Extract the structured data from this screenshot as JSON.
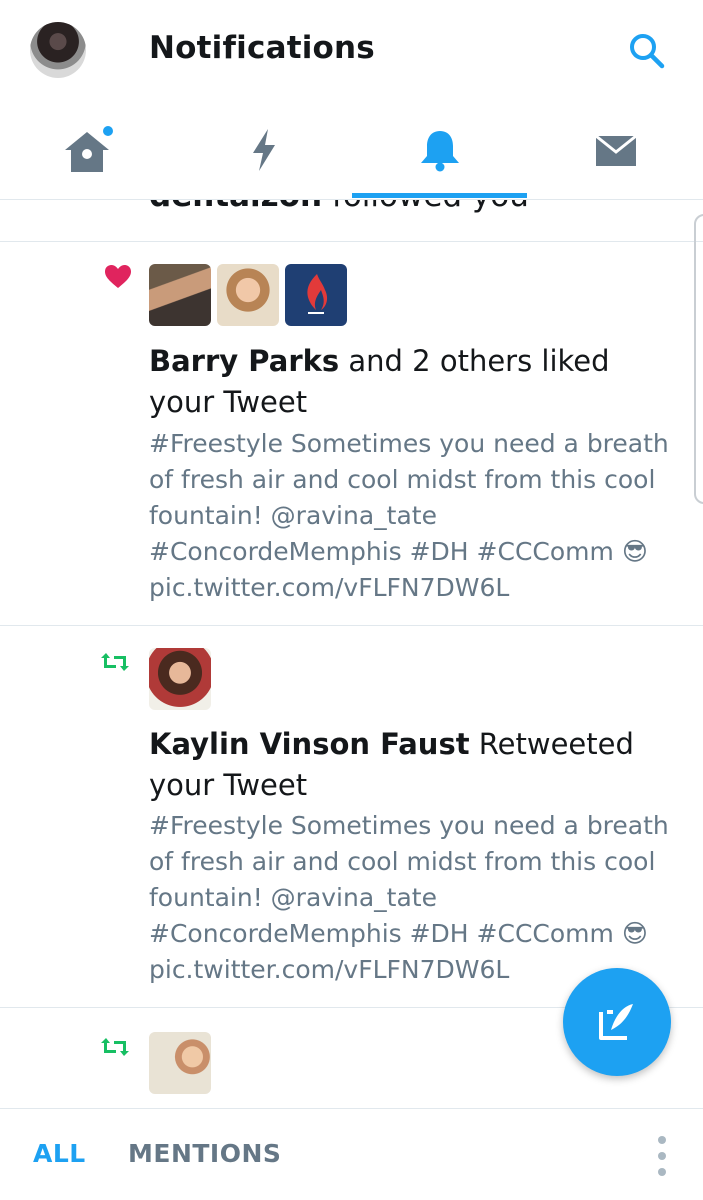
{
  "header": {
    "title": "Notifications"
  },
  "tabs": [
    {
      "name": "home",
      "icon": "home-icon",
      "has_dot": true
    },
    {
      "name": "moments",
      "icon": "lightning-icon"
    },
    {
      "name": "notifications",
      "icon": "bell-icon",
      "active": true
    },
    {
      "name": "messages",
      "icon": "envelope-icon"
    }
  ],
  "feed": {
    "partial_top": {
      "user": "dentalzon",
      "action": " followed you"
    },
    "items": [
      {
        "type": "like",
        "icon": "heart-icon",
        "actor": "Barry Parks",
        "action": " and 2 others liked your Tweet",
        "tweet": "#Freestyle Sometimes you need a breath of fresh air and cool midst from this cool fountain! @ravina_tate #ConcordeMemphis #DH #CCComm 😎 pic.twitter.com/vFLFN7DW6L"
      },
      {
        "type": "retweet",
        "icon": "retweet-icon",
        "actor": "Kaylin Vinson Faust",
        "action": " Retweeted your Tweet",
        "tweet": "#Freestyle Sometimes you need a breath of fresh air and cool midst from this cool fountain! @ravina_tate #ConcordeMemphis #DH #CCComm 😎 pic.twitter.com/vFLFN7DW6L"
      },
      {
        "type": "retweet",
        "icon": "retweet-icon"
      }
    ]
  },
  "fab": {
    "icon": "compose-tweet-icon"
  },
  "bottom_bar": {
    "filter_all": "ALL",
    "filter_mentions": "MENTIONS",
    "overflow_icon": "more-vertical-icon"
  },
  "colors": {
    "accent": "#1da1f2",
    "like": "#e0245e",
    "retweet": "#17bf63",
    "secondary_text": "#657786",
    "tab_icon": "#657786"
  }
}
